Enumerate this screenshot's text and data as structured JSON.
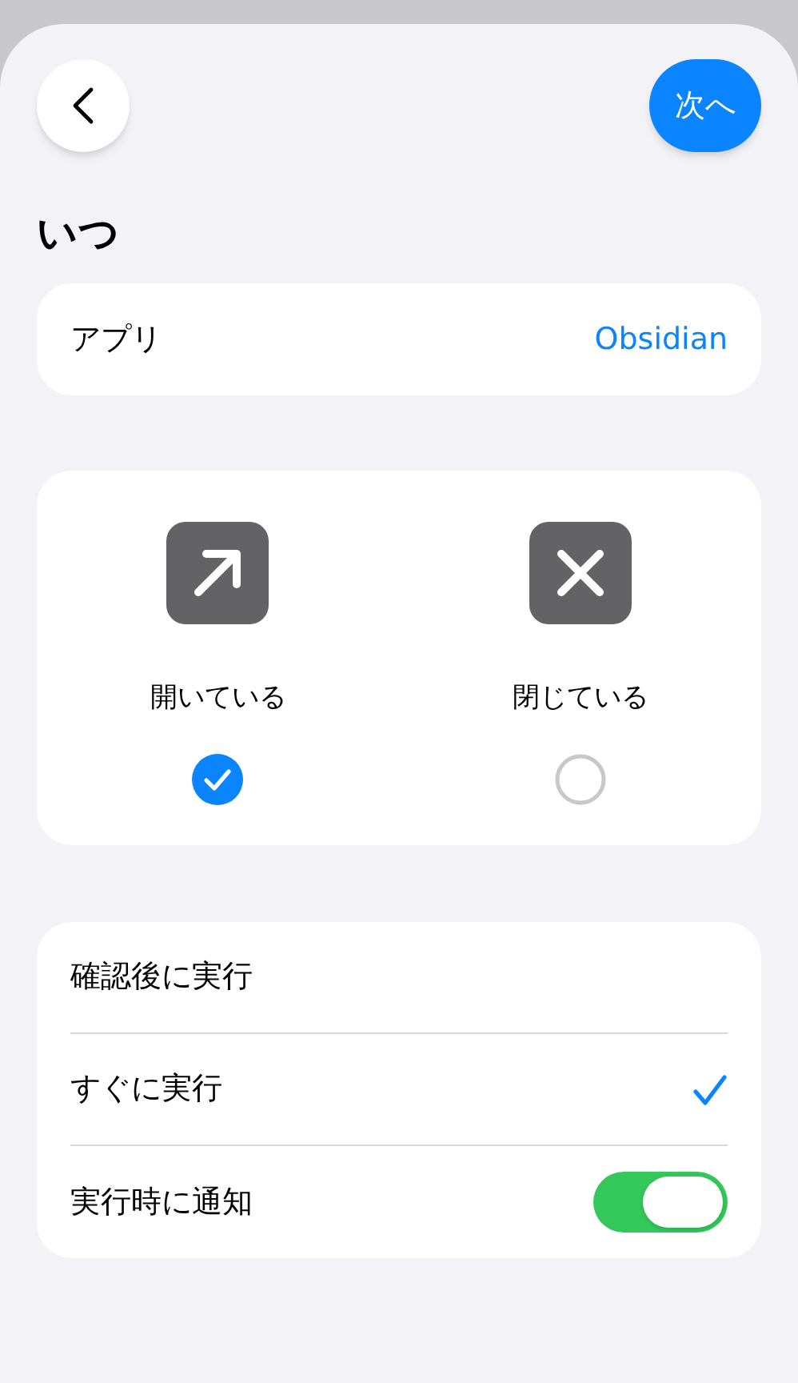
{
  "header": {
    "next_button": "次へ"
  },
  "title": "いつ",
  "app_row": {
    "label": "アプリ",
    "value": "Obsidian"
  },
  "triggers": [
    {
      "label": "開いている",
      "kind": "open",
      "selected": true
    },
    {
      "label": "閉じている",
      "kind": "close",
      "selected": false
    }
  ],
  "options": [
    {
      "label": "確認後に実行",
      "kind": "choice",
      "selected": false
    },
    {
      "label": "すぐに実行",
      "kind": "choice",
      "selected": true
    },
    {
      "label": "実行時に通知",
      "kind": "toggle",
      "on": true
    }
  ]
}
